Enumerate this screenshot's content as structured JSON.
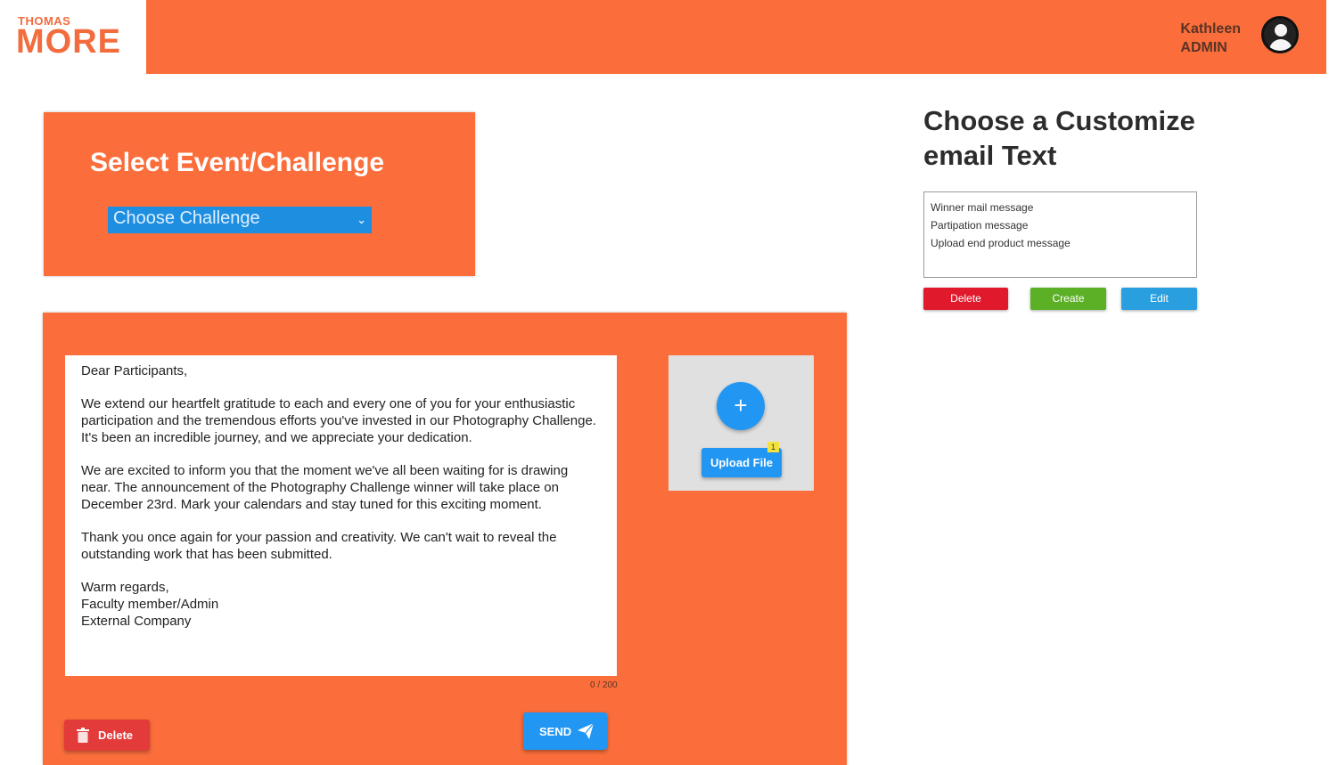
{
  "logo": {
    "line1": "THOMAS",
    "line2": "MORE"
  },
  "user": {
    "name": "Kathleen",
    "role": "ADMIN"
  },
  "select_panel": {
    "title": "Select Event/Challenge",
    "dropdown_value": "Choose Challenge"
  },
  "templates": {
    "title": "Choose a Customize email Text",
    "items": [
      "Winner mail message",
      "Partipation message",
      "Upload end product message"
    ],
    "delete_label": "Delete",
    "create_label": "Create",
    "edit_label": "Edit"
  },
  "email": {
    "greeting": "Dear Participants,",
    "para1": "We extend our heartfelt gratitude to each and every one of you for your enthusiastic participation and the tremendous efforts you've invested in our Photography Challenge. It's been an incredible journey, and we appreciate your dedication.",
    "para2": "We are excited to inform you that the moment we've all been waiting for is drawing near. The announcement of the Photography Challenge winner will take place on December 23rd. Mark your calendars and stay tuned for this exciting moment.",
    "para3": "Thank you once again for your passion and creativity. We can't wait to reveal the outstanding work that has been submitted.",
    "closing": "Warm regards,",
    "sign1": "Faculty member/Admin",
    "sign2": "External Company",
    "counter": "0 / 200"
  },
  "upload": {
    "plus": "+",
    "label": "Upload File",
    "badge": "1"
  },
  "actions": {
    "delete_label": "Delete",
    "send_label": "SEND"
  },
  "colors": {
    "brand_orange": "#fb6e3b",
    "primary_blue": "#2196f3",
    "danger_red": "#e0192d",
    "success_green": "#5bb026"
  }
}
